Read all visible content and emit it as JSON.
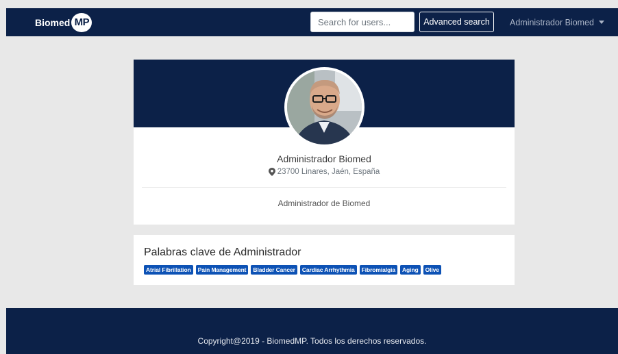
{
  "navbar": {
    "brand_text": "Biomed",
    "brand_badge": "MP",
    "search": {
      "placeholder": "Search for users..."
    },
    "advanced_search_label": "Advanced search",
    "user_menu_label": "Administrador Biomed",
    "bg_color": "#0c2148"
  },
  "profile": {
    "name": "Administrador Biomed",
    "location": "23700 Linares, Jaén, España",
    "location_icon": "map-marker-icon",
    "description": "Administrador de Biomed"
  },
  "keywords": {
    "title": "Palabras clave de Administrador",
    "items": [
      "Atrial Fibrillation",
      "Pain Management",
      "Bladder Cancer",
      "Cardiac Arrhythmia",
      "Fibromialgia",
      "Aging",
      "Olive"
    ],
    "badge_color": "#0d52b5"
  },
  "footer": {
    "copyright": "Copyright@2019 - BiomedMP. Todos los derechos reservados."
  }
}
